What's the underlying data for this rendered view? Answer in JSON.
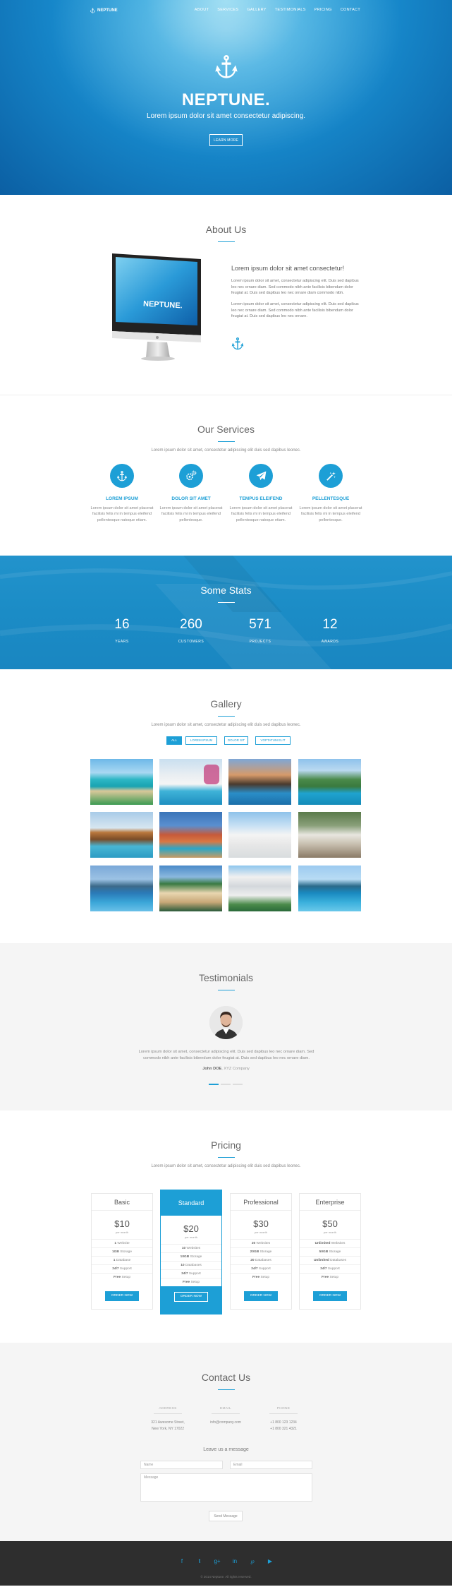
{
  "nav": {
    "logo": "NEPTUNE",
    "items": [
      "ABOUT",
      "SERVICES",
      "GALLERY",
      "TESTIMONIALS",
      "PRICING",
      "CONTACT"
    ]
  },
  "hero": {
    "title": "NEPTUNE.",
    "subtitle": "Lorem ipsum dolor sit amet consectetur adipiscing.",
    "button": "LEARN MORE"
  },
  "about": {
    "title": "About Us",
    "screen_text": "NEPTUNE.",
    "heading": "Lorem ipsum dolor sit amet consectetur!",
    "p1": "Lorem ipsum dolor sit amet, consectetur adipiscing elit. Duis sed dapibus leo nec ornare diam. Sed commodo nibh ante facilisis bibendum dolor feugiat at. Duis sed dapibus leo nec ornare diam commodo nibh.",
    "p2": "Lorem ipsum dolor sit amet, consectetur adipiscing elit. Duis sed dapibus leo nec ornare diam. Sed commodo nibh ante facilisis bibendum dolor feugiat at. Duis sed dapibus leo nec ornare."
  },
  "services": {
    "title": "Our Services",
    "subtitle": "Lorem ipsum dolor sit amet, consectetur adipiscing elit duis sed dapibus leonec.",
    "items": [
      {
        "icon": "anchor-icon",
        "title": "LOREM IPSUM",
        "text": "Lorem ipsum dolor sit amet placerat facilisis felis mi in tempus eleifend pellentesque natoque etiam."
      },
      {
        "icon": "gears-icon",
        "title": "DOLOR SIT AMET",
        "text": "Lorem ipsum dolor sit amet placerat facilisis felis mi in tempus eleifend pellentesque."
      },
      {
        "icon": "paper-plane-icon",
        "title": "TEMPUS ELEIFEND",
        "text": "Lorem ipsum dolor sit amet placerat facilisis felis mi in tempus eleifend pellentesque natoque etiam."
      },
      {
        "icon": "magic-wand-icon",
        "title": "PELLENTESQUE",
        "text": "Lorem ipsum dolor sit amet placerat facilisis felis mi in tempus eleifend pellentesque."
      }
    ]
  },
  "stats": {
    "title": "Some Stats",
    "items": [
      {
        "number": "16",
        "label": "YEARS"
      },
      {
        "number": "260",
        "label": "CUSTOMERS"
      },
      {
        "number": "571",
        "label": "PROJECTS"
      },
      {
        "number": "12",
        "label": "AWARDS"
      }
    ]
  },
  "gallery": {
    "title": "Gallery",
    "subtitle": "Lorem ipsum dolor sit amet, consectetur adipiscing elit duis sed dapibus leonec.",
    "filters": [
      "ALL",
      "LOREM IPSUM",
      "DOLOR SIT",
      "VOPTATUM ELIT"
    ]
  },
  "testimonials": {
    "title": "Testimonials",
    "quote": "Lorem ipsum dolor sit amet, consectetur adipiscing elit. Duis sed dapibus leo nec ornare diam. Sed commodo nibh ante facilisis bibendum dolor feugiat at. Duis sed dapibus leo nec ornare diam.",
    "author_name": "John DOE",
    "author_company": ", XYZ Company"
  },
  "pricing": {
    "title": "Pricing",
    "subtitle": "Lorem ipsum dolor sit amet, consectetur adipiscing elit duis sed dapibus leonec.",
    "per": "per month",
    "button": "ORDER NOW",
    "plans": [
      {
        "name": "Basic",
        "price": "$10",
        "features": [
          [
            "1",
            " Website"
          ],
          [
            "1GB",
            " Storage"
          ],
          [
            "1",
            " Database"
          ],
          [
            "24/7",
            " Support"
          ],
          [
            "Free",
            " Setup"
          ]
        ]
      },
      {
        "name": "Standard",
        "price": "$20",
        "features": [
          [
            "10",
            " Websites"
          ],
          [
            "10GB",
            " Storage"
          ],
          [
            "10",
            " Databases"
          ],
          [
            "24/7",
            " Support"
          ],
          [
            "Free",
            " Setup"
          ]
        ]
      },
      {
        "name": "Professional",
        "price": "$30",
        "features": [
          [
            "20",
            " Websites"
          ],
          [
            "20GB",
            " Storage"
          ],
          [
            "20",
            " Databases"
          ],
          [
            "24/7",
            " Support"
          ],
          [
            "Free",
            " Setup"
          ]
        ]
      },
      {
        "name": "Enterprise",
        "price": "$50",
        "features": [
          [
            "Unlimited",
            " Websites"
          ],
          [
            "50GB",
            " Storage"
          ],
          [
            "Unlimited",
            " Databases"
          ],
          [
            "24/7",
            " Support"
          ],
          [
            "Free",
            " Setup"
          ]
        ]
      }
    ]
  },
  "contact": {
    "title": "Contact Us",
    "address_label": "ADDRESS",
    "address": [
      "321 Awesome Street,",
      "New York, NY 17022"
    ],
    "email_label": "EMAIL",
    "email": "info@company.com",
    "phone_label": "PHONE",
    "phone": [
      "+1 800 123 1234",
      "+1 800 321 4321"
    ],
    "leave": "Leave us a message",
    "name_placeholder": "Name",
    "email_placeholder": "Email",
    "message_placeholder": "Message",
    "send": "Send Message"
  },
  "footer": {
    "social": [
      "facebook-icon",
      "twitter-icon",
      "google-plus-icon",
      "linkedin-icon",
      "pinterest-icon",
      "youtube-icon"
    ],
    "copyright": "© 2014 Neptune. All rights reserved."
  },
  "colors": {
    "accent": "#1d9fd6",
    "footer": "#2e2e2e"
  }
}
